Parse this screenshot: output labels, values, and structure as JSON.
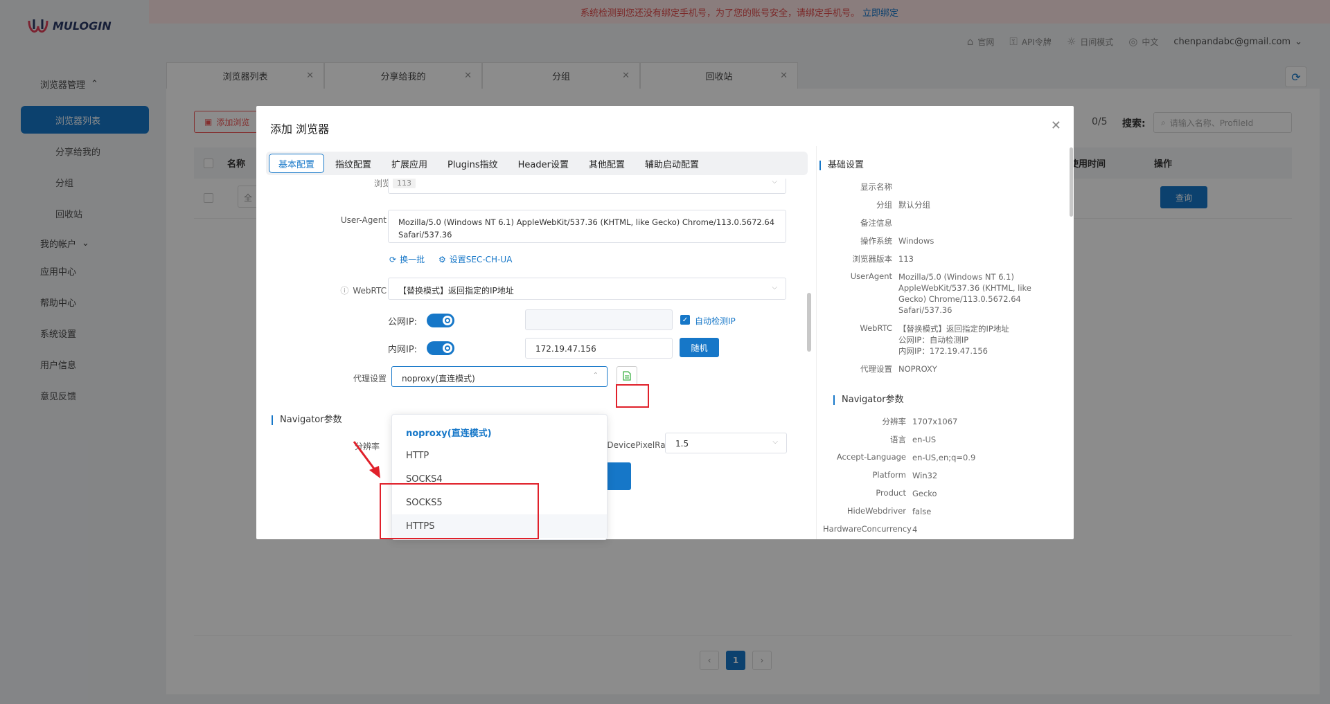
{
  "banner": {
    "text": "系统检测到您还没有绑定手机号，为了您的账号安全，请绑定手机号。",
    "link": "立即绑定"
  },
  "logo": {
    "text": "MULOGIN"
  },
  "header": {
    "items": [
      {
        "icon": "home-icon",
        "label": "官网"
      },
      {
        "icon": "api-key-icon",
        "label": "API令牌"
      },
      {
        "icon": "sun-icon",
        "label": "日间模式"
      },
      {
        "icon": "globe-icon",
        "label": "中文"
      }
    ],
    "email": "chenpandabc@gmail.com"
  },
  "sidebar": {
    "browser_mgmt": "浏览器管理",
    "items": [
      "浏览器列表",
      "分享给我的",
      "分组",
      "回收站"
    ],
    "my_account": "我的帐户",
    "sections": [
      "应用中心",
      "帮助中心",
      "系统设置",
      "用户信息",
      "意见反馈"
    ]
  },
  "tabs": [
    "浏览器列表",
    "分享给我的",
    "分组",
    "回收站"
  ],
  "content": {
    "add_button": "添加浏览",
    "count": "0/5",
    "search_label": "搜索:",
    "search_placeholder": "请输入名称、ProfileId",
    "columns": [
      "名称",
      "使用时间",
      "操作"
    ],
    "row_cell": "全",
    "query_button": "查询",
    "page": "1"
  },
  "modal": {
    "title": "添加 浏览器",
    "tabs": [
      "基本配置",
      "指纹配置",
      "扩展应用",
      "Plugins指纹",
      "Header设置",
      "其他配置",
      "辅助启动配置"
    ],
    "browser_version_label": "浏览器版本",
    "browser_version_value": "113",
    "ua_label": "User-Agent",
    "ua_value": "Mozilla/5.0 (Windows NT 6.1) AppleWebKit/537.36 (KHTML, like Gecko) Chrome/113.0.5672.64 Safari/537.36",
    "change_batch": "换一批",
    "set_sec_ch_ua": "设置SEC-CH-UA",
    "webrtc_label": "WebRTC",
    "webrtc_value": "【替换模式】返回指定的IP地址",
    "public_ip_label": "公网IP:",
    "auto_detect_ip": "自动检测IP",
    "internal_ip_label": "内网IP:",
    "internal_ip_value": "172.19.47.156",
    "random_button": "随机",
    "proxy_label": "代理设置",
    "proxy_value": "noproxy(直连模式)",
    "navigator_section": "Navigator参数",
    "resolution_label": "分辨率",
    "dpr_label": "DevicePixelRatio",
    "dpr_value": "1.5",
    "proxy_options": [
      "noproxy(直连模式)",
      "HTTP",
      "SOCKS4",
      "SOCKS5",
      "HTTPS"
    ]
  },
  "summary": {
    "basic_section": "基础设置",
    "basic": [
      {
        "k": "显示名称",
        "v": ""
      },
      {
        "k": "分组",
        "v": "默认分组"
      },
      {
        "k": "备注信息",
        "v": ""
      },
      {
        "k": "操作系统",
        "v": "Windows"
      },
      {
        "k": "浏览器版本",
        "v": "113"
      }
    ],
    "ua_key": "UserAgent",
    "ua_lines": [
      "Mozilla/5.0 (Windows NT 6.1)",
      "AppleWebKit/537.36 (KHTML, like",
      "Gecko) Chrome/113.0.5672.64",
      "Safari/537.36"
    ],
    "webrtc_key": "WebRTC",
    "webrtc_lines": [
      "【替换模式】返回指定的IP地址",
      "公网IP：自动检测IP",
      "内网IP：172.19.47.156"
    ],
    "proxy_key": "代理设置",
    "proxy_val": "NOPROXY",
    "nav_section": "Navigator参数",
    "nav": [
      {
        "k": "分辨率",
        "v": "1707x1067"
      },
      {
        "k": "语言",
        "v": "en-US"
      },
      {
        "k": "Accept-Language",
        "v": "en-US,en;q=0.9"
      },
      {
        "k": "Platform",
        "v": "Win32"
      },
      {
        "k": "Product",
        "v": "Gecko"
      },
      {
        "k": "HideWebdriver",
        "v": "false"
      },
      {
        "k": "HardwareConcurrency",
        "v": "4"
      }
    ]
  },
  "colors": {
    "primary": "#1677c8",
    "highlight": "#e0202a",
    "banner_bg": "#fbe3e3"
  }
}
